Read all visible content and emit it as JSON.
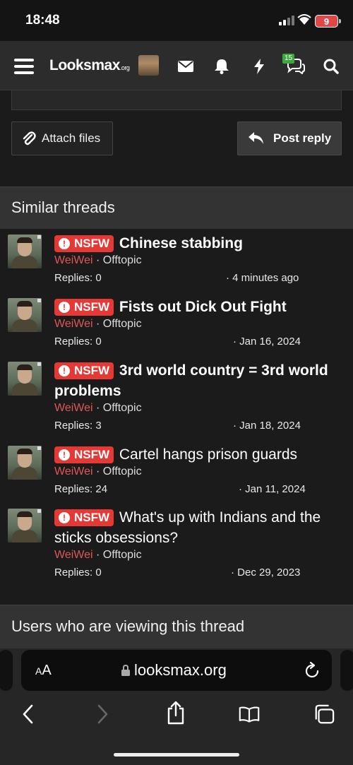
{
  "status_bar": {
    "time": "18:48",
    "battery": "9"
  },
  "nav": {
    "logo_text": "Lo",
    "logo_o": "o",
    "logo_rest": "ksmax",
    "logo_tld": ".org",
    "alerts_badge": "15"
  },
  "actions": {
    "attach_label": "Attach files",
    "post_label": "Post reply"
  },
  "similar": {
    "heading": "Similar threads",
    "prefix": "NSFW",
    "threads": [
      {
        "title": "Chinese stabbing",
        "author": "WeiWei",
        "forum": "Offtopic",
        "replies": "Replies: 0",
        "date": "4 minutes ago",
        "bold": true
      },
      {
        "title": "Fists out Dick Out Fight",
        "author": "WeiWei",
        "forum": "Offtopic",
        "replies": "Replies: 0",
        "date": "Jan 16, 2024",
        "bold": true
      },
      {
        "title": "3rd world country = 3rd world problems",
        "author": "WeiWei",
        "forum": "Offtopic",
        "replies": "Replies: 3",
        "date": "Jan 18, 2024",
        "bold": true
      },
      {
        "title": "Cartel hangs prison guards",
        "author": "WeiWei",
        "forum": "Offtopic",
        "replies": "Replies: 24",
        "date": "Jan 11, 2024",
        "bold": false
      },
      {
        "title": "What's up with Indians and the sticks obsessions?",
        "author": "WeiWei",
        "forum": "Offtopic",
        "replies": "Replies: 0",
        "date": "Dec 29, 2023",
        "bold": false
      }
    ]
  },
  "users_viewing": {
    "heading": "Users who are viewing this thread"
  },
  "safari": {
    "aa_big": "A",
    "aa_small": "A",
    "url": "looksmax.org"
  },
  "colors": {
    "nsfw": "#e53935",
    "author": "#e05656",
    "badge": "#3ea83e"
  }
}
